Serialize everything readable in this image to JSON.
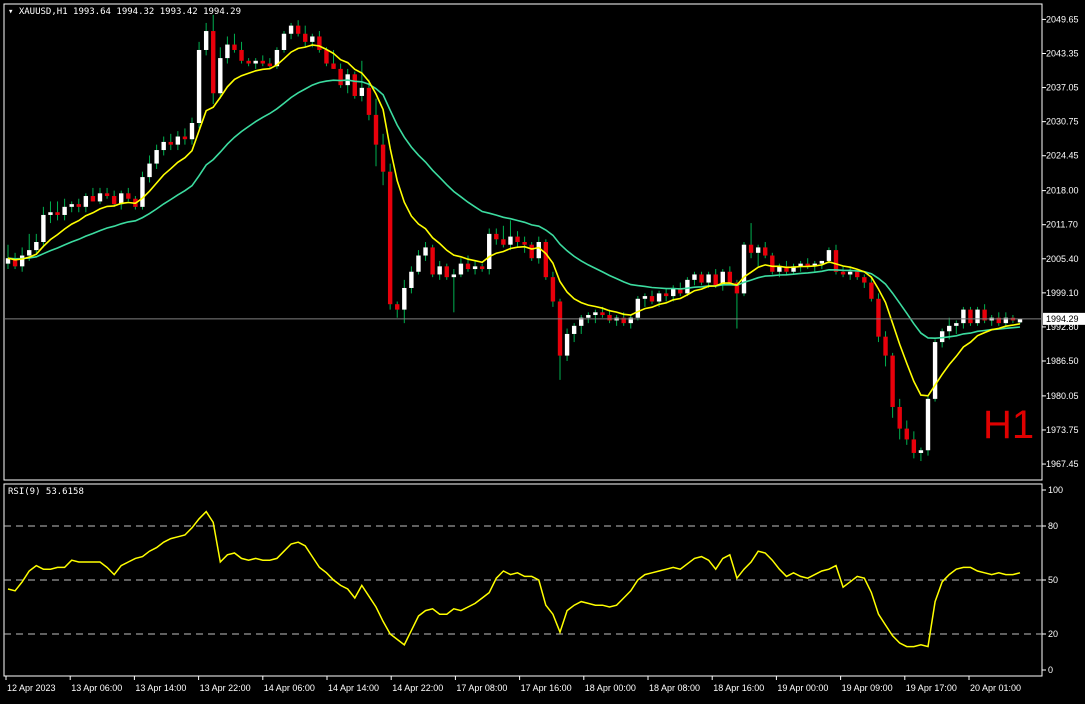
{
  "header": {
    "symbol_label": "XAUUSD,H1",
    "ohlc_label": "1993.64 1994.32 1993.42 1994.29"
  },
  "timeframe_watermark": "H1",
  "rsi_panel": {
    "label": "RSI(9) 53.6158"
  },
  "colors": {
    "background": "#000000",
    "bull_body": "#ffffff",
    "bear_body": "#e8000b",
    "wick": "#00b050",
    "fast_ma": "#ffff00",
    "slow_ma": "#3cdca0",
    "rsi_line": "#ffff00",
    "grid_dash": "#c0c0c0",
    "price_line": "#808080"
  },
  "chart_data": [
    {
      "type": "candlestick",
      "symbol": "XAUUSD",
      "timeframe": "H1",
      "last_price": "1994.29",
      "price_axis_ticks": [
        "2049.65",
        "2043.35",
        "2037.05",
        "2030.75",
        "2024.45",
        "2018.00",
        "2011.70",
        "2005.40",
        "1999.10",
        "1992.80",
        "1986.50",
        "1980.05",
        "1973.75",
        "1967.45"
      ],
      "time_axis_labels": [
        "12 Apr 2023",
        "13 Apr 06:00",
        "13 Apr 14:00",
        "13 Apr 22:00",
        "14 Apr 06:00",
        "14 Apr 14:00",
        "14 Apr 22:00",
        "17 Apr 08:00",
        "17 Apr 16:00",
        "18 Apr 00:00",
        "18 Apr 08:00",
        "18 Apr 16:00",
        "19 Apr 00:00",
        "19 Apr 09:00",
        "19 Apr 17:00",
        "20 Apr 01:00"
      ],
      "ylim": [
        1964.5,
        2052.5
      ],
      "candles": [
        [
          2004.5,
          2008.0,
          2003.5,
          2005.5
        ],
        [
          2005.5,
          2006.5,
          2003.5,
          2004.0
        ],
        [
          2004.0,
          2007.5,
          2003.0,
          2006.0
        ],
        [
          2006.0,
          2010.0,
          2005.0,
          2007.0
        ],
        [
          2007.0,
          2010.0,
          2006.5,
          2008.5
        ],
        [
          2008.5,
          2015.0,
          2007.5,
          2013.5
        ],
        [
          2013.5,
          2016.0,
          2012.0,
          2014.0
        ],
        [
          2014.0,
          2016.0,
          2012.5,
          2013.5
        ],
        [
          2013.5,
          2016.5,
          2012.5,
          2015.0
        ],
        [
          2015.0,
          2016.0,
          2014.0,
          2015.5
        ],
        [
          2015.5,
          2016.5,
          2014.0,
          2015.0
        ],
        [
          2015.0,
          2017.5,
          2014.0,
          2017.0
        ],
        [
          2017.0,
          2018.5,
          2016.0,
          2016.0
        ],
        [
          2016.0,
          2018.5,
          2015.5,
          2017.5
        ],
        [
          2017.5,
          2018.5,
          2016.5,
          2017.0
        ],
        [
          2017.0,
          2018.0,
          2015.0,
          2015.5
        ],
        [
          2015.5,
          2018.0,
          2014.5,
          2017.5
        ],
        [
          2017.5,
          2018.5,
          2016.0,
          2016.5
        ],
        [
          2016.5,
          2017.0,
          2014.5,
          2015.0
        ],
        [
          2015.0,
          2021.5,
          2014.5,
          2020.5
        ],
        [
          2020.5,
          2024.5,
          2019.5,
          2023.0
        ],
        [
          2023.0,
          2026.5,
          2022.0,
          2025.5
        ],
        [
          2025.5,
          2028.0,
          2024.5,
          2027.0
        ],
        [
          2027.0,
          2028.5,
          2025.5,
          2026.5
        ],
        [
          2026.5,
          2029.0,
          2025.5,
          2028.0
        ],
        [
          2028.0,
          2029.5,
          2026.5,
          2027.5
        ],
        [
          2027.5,
          2031.5,
          2026.5,
          2030.5
        ],
        [
          2030.5,
          2045.5,
          2029.5,
          2044.0
        ],
        [
          2044.0,
          2049.0,
          2043.0,
          2047.5
        ],
        [
          2047.5,
          2050.5,
          2034.0,
          2036.0
        ],
        [
          2036.0,
          2044.5,
          2035.0,
          2042.5
        ],
        [
          2042.5,
          2046.5,
          2041.5,
          2045.0
        ],
        [
          2045.0,
          2047.0,
          2043.5,
          2044.0
        ],
        [
          2044.0,
          2045.5,
          2041.5,
          2042.0
        ],
        [
          2042.0,
          2042.5,
          2041.0,
          2041.5
        ],
        [
          2041.5,
          2042.5,
          2040.5,
          2042.0
        ],
        [
          2042.0,
          2043.0,
          2041.0,
          2041.5
        ],
        [
          2041.5,
          2042.5,
          2040.5,
          2041.0
        ],
        [
          2041.0,
          2044.5,
          2040.5,
          2044.0
        ],
        [
          2044.0,
          2047.5,
          2043.5,
          2047.0
        ],
        [
          2047.0,
          2049.0,
          2046.0,
          2048.5
        ],
        [
          2048.5,
          2049.5,
          2046.5,
          2047.0
        ],
        [
          2047.0,
          2048.5,
          2044.5,
          2045.5
        ],
        [
          2045.5,
          2047.0,
          2044.5,
          2046.5
        ],
        [
          2046.5,
          2047.5,
          2043.5,
          2044.0
        ],
        [
          2044.0,
          2044.5,
          2041.0,
          2041.5
        ],
        [
          2041.5,
          2044.0,
          2040.5,
          2040.5
        ],
        [
          2040.5,
          2041.5,
          2037.0,
          2037.5
        ],
        [
          2037.5,
          2040.5,
          2036.0,
          2039.5
        ],
        [
          2039.5,
          2040.0,
          2035.0,
          2035.5
        ],
        [
          2035.5,
          2042.0,
          2034.5,
          2037.0
        ],
        [
          2037.0,
          2038.5,
          2031.0,
          2032.0
        ],
        [
          2032.0,
          2035.0,
          2022.5,
          2026.5
        ],
        [
          2026.5,
          2028.5,
          2019.0,
          2021.5
        ],
        [
          2021.5,
          2023.0,
          1996.0,
          1997.0
        ],
        [
          1997.0,
          1997.5,
          1994.5,
          1996.0
        ],
        [
          1996.0,
          2001.5,
          1993.5,
          2000.0
        ],
        [
          2000.0,
          2004.0,
          1999.0,
          2003.0
        ],
        [
          2003.0,
          2007.0,
          2002.5,
          2006.0
        ],
        [
          2006.0,
          2008.5,
          2005.0,
          2007.5
        ],
        [
          2007.5,
          2008.0,
          2002.0,
          2002.5
        ],
        [
          2002.5,
          2005.0,
          2001.5,
          2004.0
        ],
        [
          2004.0,
          2004.5,
          2001.5,
          2002.0
        ],
        [
          2002.0,
          2003.5,
          1995.5,
          2002.5
        ],
        [
          2002.5,
          2005.5,
          2002.0,
          2004.5
        ],
        [
          2004.5,
          2006.0,
          2003.0,
          2003.5
        ],
        [
          2003.5,
          2005.0,
          2002.5,
          2004.0
        ],
        [
          2004.0,
          2004.5,
          2003.0,
          2003.5
        ],
        [
          2003.5,
          2011.0,
          2002.5,
          2010.0
        ],
        [
          2010.0,
          2011.0,
          2008.0,
          2009.0
        ],
        [
          2009.0,
          2011.5,
          2007.5,
          2008.0
        ],
        [
          2008.0,
          2012.5,
          2007.0,
          2009.5
        ],
        [
          2009.5,
          2010.5,
          2007.5,
          2008.5
        ],
        [
          2008.5,
          2009.5,
          2006.5,
          2008.0
        ],
        [
          2008.0,
          2008.5,
          2005.0,
          2005.5
        ],
        [
          2005.5,
          2009.5,
          2004.5,
          2008.5
        ],
        [
          2008.5,
          2009.0,
          2001.5,
          2002.0
        ],
        [
          2002.0,
          2003.0,
          1996.5,
          1997.5
        ],
        [
          1997.5,
          1998.0,
          1983.0,
          1987.5
        ],
        [
          1987.5,
          1992.5,
          1986.5,
          1991.5
        ],
        [
          1991.5,
          1993.5,
          1990.0,
          1993.0
        ],
        [
          1993.0,
          1995.0,
          1991.5,
          1994.5
        ],
        [
          1994.5,
          1995.5,
          1993.5,
          1995.0
        ],
        [
          1995.0,
          1996.0,
          1993.5,
          1995.5
        ],
        [
          1995.5,
          1996.5,
          1994.5,
          1995.0
        ],
        [
          1995.0,
          1996.0,
          1993.5,
          1994.0
        ],
        [
          1994.0,
          1995.0,
          1993.0,
          1994.5
        ],
        [
          1994.5,
          1995.5,
          1993.0,
          1993.5
        ],
        [
          1993.5,
          1995.0,
          1992.5,
          1994.5
        ],
        [
          1994.5,
          1998.5,
          1994.0,
          1998.0
        ],
        [
          1998.0,
          1999.0,
          1996.5,
          1998.5
        ],
        [
          1998.5,
          1999.5,
          1997.0,
          1997.5
        ],
        [
          1997.5,
          1999.5,
          1996.5,
          1999.0
        ],
        [
          1999.0,
          2000.0,
          1997.5,
          1998.5
        ],
        [
          1998.5,
          2000.5,
          1997.5,
          2000.0
        ],
        [
          2000.0,
          2001.0,
          1998.5,
          1999.0
        ],
        [
          1999.0,
          2002.0,
          1998.5,
          2001.5
        ],
        [
          2001.5,
          2003.0,
          2000.5,
          2002.5
        ],
        [
          2002.5,
          2003.0,
          2000.5,
          2001.0
        ],
        [
          2001.0,
          2003.0,
          2000.0,
          2002.5
        ],
        [
          2002.5,
          2003.5,
          2000.0,
          2000.5
        ],
        [
          2000.5,
          2003.5,
          1999.5,
          2003.0
        ],
        [
          2003.0,
          2004.0,
          2000.5,
          2001.0
        ],
        [
          2001.0,
          2001.5,
          1992.5,
          1999.0
        ],
        [
          1999.0,
          2008.5,
          1998.5,
          2008.0
        ],
        [
          2008.0,
          2012.0,
          2005.5,
          2006.5
        ],
        [
          2006.5,
          2008.0,
          2004.0,
          2007.5
        ],
        [
          2007.5,
          2008.5,
          2005.5,
          2006.0
        ],
        [
          2006.0,
          2006.5,
          2002.5,
          2003.0
        ],
        [
          2003.0,
          2004.5,
          2002.0,
          2004.0
        ],
        [
          2004.0,
          2005.0,
          2002.5,
          2003.0
        ],
        [
          2003.0,
          2004.5,
          2002.5,
          2004.0
        ],
        [
          2004.0,
          2005.0,
          2003.0,
          2004.5
        ],
        [
          2004.5,
          2005.5,
          2003.5,
          2004.0
        ],
        [
          2004.0,
          2005.0,
          2003.0,
          2004.5
        ],
        [
          2004.5,
          2005.0,
          2003.5,
          2005.0
        ],
        [
          2005.0,
          2007.5,
          2004.5,
          2007.0
        ],
        [
          2007.0,
          2008.0,
          2002.5,
          2003.0
        ],
        [
          2003.0,
          2004.0,
          2002.0,
          2002.5
        ],
        [
          2002.5,
          2004.0,
          2001.5,
          2003.0
        ],
        [
          2003.0,
          2003.5,
          2001.5,
          2002.0
        ],
        [
          2002.0,
          2002.5,
          2000.0,
          2001.0
        ],
        [
          2001.0,
          2002.0,
          1997.5,
          1998.0
        ],
        [
          1998.0,
          1999.0,
          1990.0,
          1991.0
        ],
        [
          1991.0,
          1992.0,
          1985.5,
          1987.5
        ],
        [
          1987.5,
          1988.0,
          1976.0,
          1978.0
        ],
        [
          1978.0,
          1979.5,
          1972.0,
          1974.0
        ],
        [
          1974.0,
          1975.5,
          1971.0,
          1972.0
        ],
        [
          1972.0,
          1973.5,
          1968.5,
          1969.5
        ],
        [
          1969.5,
          1970.5,
          1968.0,
          1970.0
        ],
        [
          1970.0,
          1980.0,
          1969.0,
          1979.5
        ],
        [
          1979.5,
          1990.5,
          1979.0,
          1990.0
        ],
        [
          1990.0,
          1992.5,
          1989.0,
          1992.0
        ],
        [
          1992.0,
          1994.5,
          1990.5,
          1993.0
        ],
        [
          1993.0,
          1994.0,
          1991.5,
          1993.5
        ],
        [
          1993.5,
          1996.5,
          1992.5,
          1996.0
        ],
        [
          1996.0,
          1996.5,
          1993.0,
          1993.5
        ],
        [
          1993.5,
          1996.5,
          1993.0,
          1996.0
        ],
        [
          1996.0,
          1997.0,
          1993.5,
          1994.0
        ],
        [
          1994.0,
          1995.0,
          1993.0,
          1994.5
        ],
        [
          1994.5,
          1995.5,
          1993.0,
          1993.5
        ],
        [
          1993.5,
          1995.5,
          1993.0,
          1994.5
        ],
        [
          1994.5,
          1995.0,
          1993.5,
          1994.0
        ],
        [
          1993.64,
          1994.32,
          1993.42,
          1994.29
        ]
      ],
      "candle_format": [
        "open",
        "high",
        "low",
        "close"
      ]
    },
    {
      "type": "line",
      "indicator": "RSI(9)",
      "rsi_value": "53.6158",
      "ylim": [
        0,
        100
      ],
      "levels_ticks": [
        "100",
        "80",
        "50",
        "20",
        "0"
      ],
      "levels": [
        80,
        50,
        20
      ],
      "values": [
        45,
        44,
        49,
        55,
        58,
        56,
        56,
        57,
        57,
        61,
        60,
        60,
        60,
        60,
        57,
        53,
        58,
        60,
        62,
        63,
        66,
        68,
        71,
        73,
        74,
        75,
        79,
        84,
        88,
        82,
        60,
        64,
        65,
        62,
        61,
        62,
        61,
        61,
        62,
        66,
        70,
        71,
        69,
        63,
        57,
        54,
        50,
        47,
        45,
        40,
        47,
        41,
        35,
        27,
        20,
        17,
        14,
        22,
        30,
        33,
        34,
        31,
        31,
        34,
        33,
        35,
        37,
        40,
        43,
        51,
        55,
        53,
        54,
        52,
        52,
        50,
        36,
        31,
        21,
        33,
        36,
        38,
        37,
        36,
        36,
        35,
        36,
        40,
        44,
        50,
        53,
        54,
        55,
        56,
        57,
        56,
        59,
        62,
        63,
        61,
        56,
        62,
        64,
        51,
        56,
        60,
        66,
        65,
        61,
        56,
        52,
        54,
        52,
        51,
        53,
        55,
        56,
        58,
        46,
        49,
        52,
        51,
        43,
        31,
        25,
        19,
        15,
        13,
        13,
        14,
        13,
        38,
        49,
        53,
        56,
        57,
        57,
        55,
        54,
        53,
        54,
        53,
        53,
        54
      ],
      "note_ignore": ""
    }
  ]
}
